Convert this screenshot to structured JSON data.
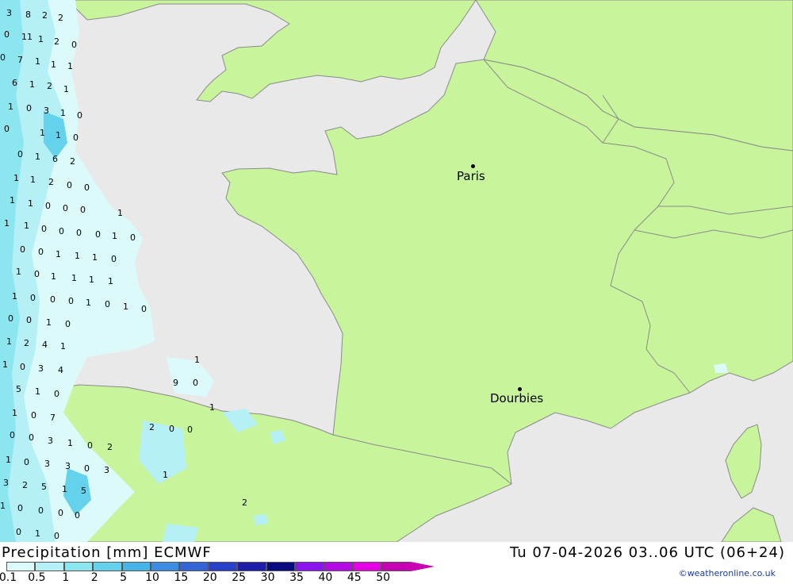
{
  "map": {
    "cities": [
      {
        "name": "Paris"
      },
      {
        "name": "Dourbies"
      }
    ],
    "precip_values": [
      "3",
      "8",
      "2",
      "2",
      "0",
      "11",
      "1",
      "2",
      "0",
      "0",
      "7",
      "1",
      "1",
      "1",
      "6",
      "1",
      "2",
      "1",
      "1",
      "0",
      "3",
      "1",
      "0",
      "0",
      "1",
      "1",
      "0",
      "0",
      "1",
      "6",
      "2",
      "1",
      "1",
      "2",
      "0",
      "0",
      "1",
      "1",
      "0",
      "0",
      "0",
      "1",
      "1",
      "1",
      "0",
      "0",
      "0",
      "0",
      "1",
      "0",
      "0",
      "0",
      "1",
      "1",
      "1",
      "0",
      "1",
      "0",
      "1",
      "1",
      "1",
      "1",
      "1",
      "0",
      "0",
      "0",
      "1",
      "0",
      "1",
      "0",
      "0",
      "0",
      "1",
      "0",
      "1",
      "2",
      "4",
      "1",
      "1",
      "1",
      "0",
      "3",
      "4",
      "9",
      "0",
      "5",
      "1",
      "0",
      "1",
      "1",
      "0",
      "7",
      "2",
      "0",
      "0",
      "0",
      "0",
      "3",
      "1",
      "0",
      "2",
      "1",
      "0",
      "3",
      "3",
      "0",
      "3",
      "1",
      "3",
      "2",
      "5",
      "1",
      "5",
      "2",
      "1",
      "0",
      "0",
      "0",
      "0",
      "0",
      "1",
      "0",
      "0",
      "0",
      "1",
      "0"
    ],
    "land_color": "#c8f59c",
    "sea_color": "#e9e9e9"
  },
  "footer": {
    "title": "Precipitation [mm] ECMWF",
    "datetime": "Tu 07-04-2026 03..06 UTC (06+24)",
    "credit": "©weatheronline.co.uk",
    "scale": [
      {
        "label": "0.1",
        "color": "#dcfafa"
      },
      {
        "label": "0.5",
        "color": "#b4f0f5"
      },
      {
        "label": "1",
        "color": "#8ce6f0"
      },
      {
        "label": "2",
        "color": "#64d2eb"
      },
      {
        "label": "5",
        "color": "#46b4e6"
      },
      {
        "label": "10",
        "color": "#3c8ce1"
      },
      {
        "label": "15",
        "color": "#3264d7"
      },
      {
        "label": "20",
        "color": "#2841c8"
      },
      {
        "label": "25",
        "color": "#1e1eaa"
      },
      {
        "label": "30",
        "color": "#0a0a82"
      },
      {
        "label": "35",
        "color": "#8c14f0"
      },
      {
        "label": "40",
        "color": "#b40ae6"
      },
      {
        "label": "45",
        "color": "#e600e6"
      },
      {
        "label": "50",
        "color": "#c800b4"
      }
    ]
  }
}
